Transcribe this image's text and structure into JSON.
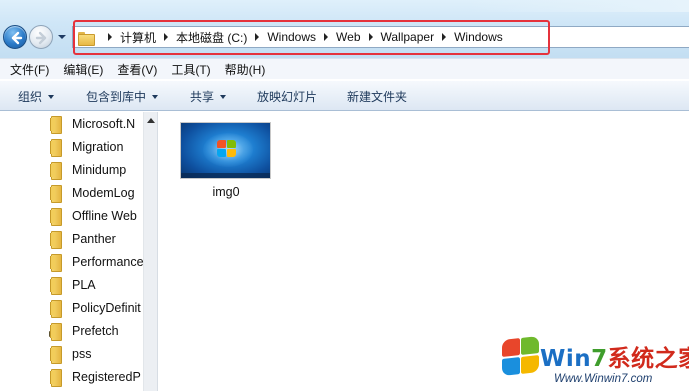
{
  "address": {
    "crumbs": [
      "计算机",
      "本地磁盘 (C:)",
      "Windows",
      "Web",
      "Wallpaper",
      "Windows"
    ]
  },
  "menu": {
    "items": [
      "文件(F)",
      "编辑(E)",
      "查看(V)",
      "工具(T)",
      "帮助(H)"
    ]
  },
  "commands": {
    "organize": "组织",
    "include_library": "包含到库中",
    "share": "共享",
    "slideshow": "放映幻灯片",
    "new_folder": "新建文件夹"
  },
  "nav_tree": {
    "items": [
      "Microsoft.N",
      "Migration",
      "Minidump",
      "ModemLog",
      "Offline Web",
      "Panther",
      "Performance",
      "PLA",
      "PolicyDefinit",
      "Prefetch",
      "pss",
      "RegisteredP"
    ]
  },
  "files": [
    {
      "name": "img0",
      "icon": "windows7-wallpaper-thumbnail"
    }
  ],
  "watermark": {
    "title_part1": "Win",
    "title_part2": "7",
    "title_part3": "系统之家",
    "url": "Www.Winwin7.com"
  },
  "colors": {
    "highlight_box": "#e5323c",
    "command_text": "#1e395b",
    "folder": "#f0c85a"
  }
}
